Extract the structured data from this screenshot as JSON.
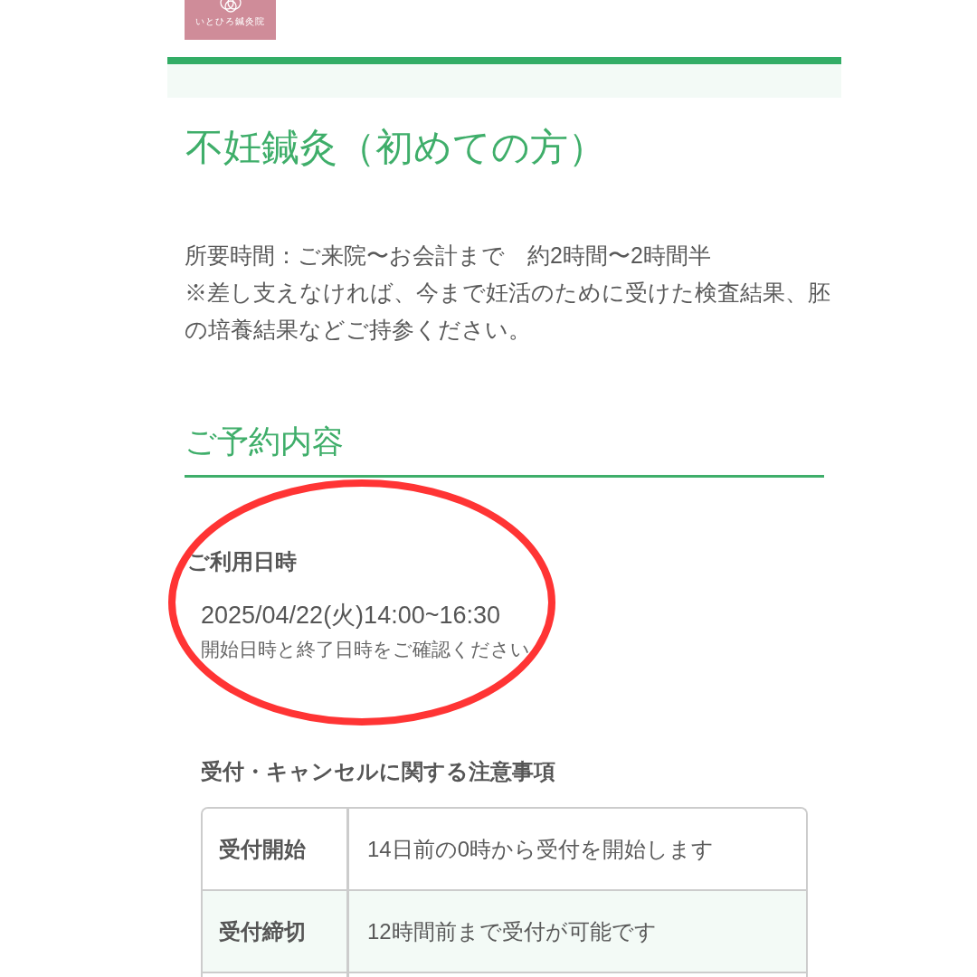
{
  "logo": {
    "text": "いとひろ鍼灸院"
  },
  "page_title": "不妊鍼灸（初めての方）",
  "description": [
    "所要時間：ご来院〜お会計まで　約2時間〜2時間半",
    "※差し支えなければ、今まで妊活のために受けた検査結果、胚の培養結果などご持参ください。"
  ],
  "reservation": {
    "heading": "ご予約内容",
    "datetime_label": "ご利用日時",
    "datetime": "2025/04/22(火)14:00~16:30",
    "datetime_note": "開始日時と終了日時をご確認ください"
  },
  "annotation": {
    "kind": "ellipse"
  },
  "notice": {
    "heading": "受付・キャンセルに関する注意事項",
    "rows": [
      {
        "label": "受付開始",
        "value": "14日前の0時から受付を開始します"
      },
      {
        "label": "受付締切",
        "value": "12時間前まで受付が可能です"
      }
    ]
  }
}
